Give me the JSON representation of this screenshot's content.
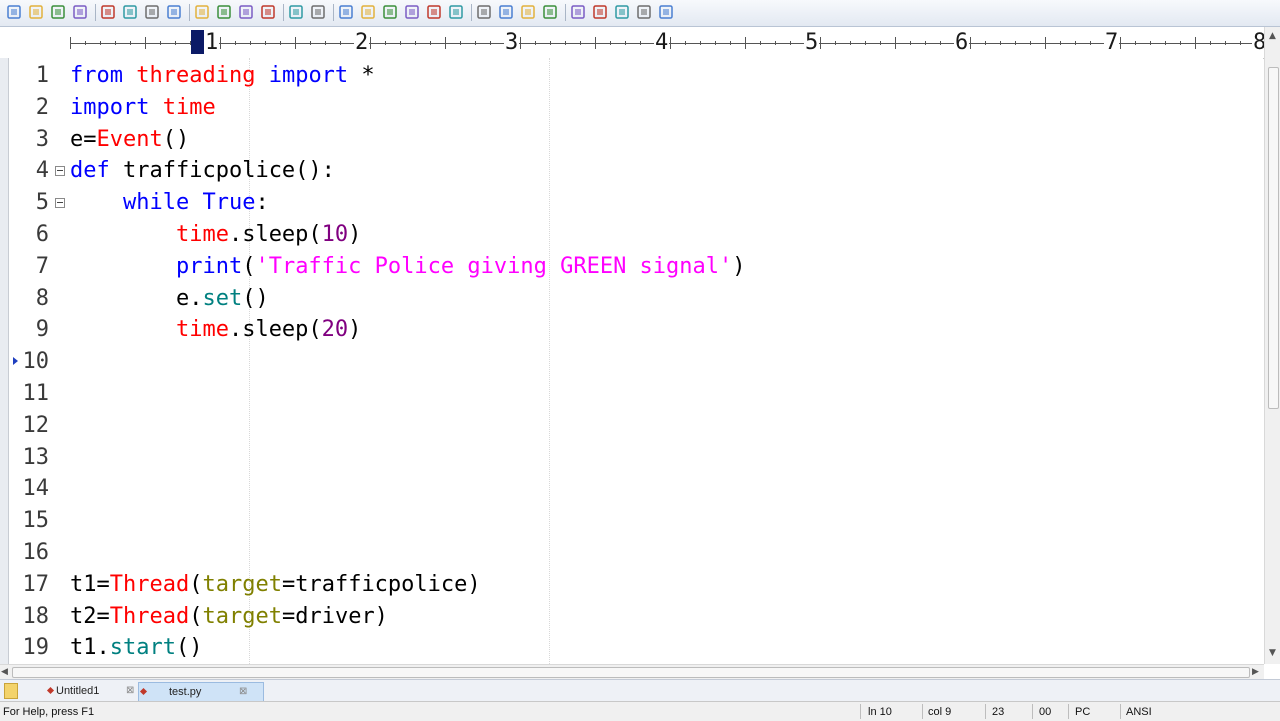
{
  "toolbar": {
    "icons": [
      "new-file-icon",
      "open-icon",
      "save-icon",
      "save-all-icon",
      "print-preview-icon",
      "print-icon",
      "spellcheck-icon",
      "properties-icon",
      "cut-icon",
      "copy-icon",
      "paste-icon",
      "delete-icon",
      "undo-icon",
      "redo-icon",
      "find-icon",
      "replace-icon",
      "find-in-files-icon",
      "goto-icon",
      "font-icon",
      "hex-icon",
      "word-wrap-icon",
      "list-icon",
      "column-icon",
      "check-icon",
      "window-tile-icon",
      "window-cascade-icon",
      "window-list-icon",
      "fullscreen-icon",
      "help-icon"
    ]
  },
  "ruler": {
    "labels": [
      "1",
      "2",
      "3",
      "4",
      "5",
      "6",
      "7",
      "8"
    ]
  },
  "editor": {
    "lines": [
      {
        "num": "1",
        "tokens": [
          [
            "kw",
            "from"
          ],
          [
            "op",
            " "
          ],
          [
            "mod",
            "threading"
          ],
          [
            "op",
            " "
          ],
          [
            "kw",
            "import"
          ],
          [
            "op",
            " *"
          ]
        ]
      },
      {
        "num": "2",
        "tokens": [
          [
            "kw",
            "import"
          ],
          [
            "op",
            " "
          ],
          [
            "mod",
            "time"
          ]
        ]
      },
      {
        "num": "3",
        "tokens": [
          [
            "op",
            "e="
          ],
          [
            "bi",
            "Event"
          ],
          [
            "op",
            "()"
          ]
        ]
      },
      {
        "num": "4",
        "fold": true,
        "tokens": [
          [
            "kw",
            "def"
          ],
          [
            "op",
            " trafficpolice():"
          ]
        ]
      },
      {
        "num": "5",
        "fold": true,
        "tokens": [
          [
            "op",
            "    "
          ],
          [
            "kw",
            "while"
          ],
          [
            "op",
            " "
          ],
          [
            "kw",
            "True"
          ],
          [
            "op",
            ":"
          ]
        ]
      },
      {
        "num": "6",
        "tokens": [
          [
            "op",
            "        "
          ],
          [
            "mod",
            "time"
          ],
          [
            "op",
            ".sleep("
          ],
          [
            "num",
            "10"
          ],
          [
            "op",
            ")"
          ]
        ]
      },
      {
        "num": "7",
        "tokens": [
          [
            "op",
            "        "
          ],
          [
            "kw",
            "print"
          ],
          [
            "op",
            "("
          ],
          [
            "str",
            "'Traffic Police giving GREEN signal'"
          ],
          [
            "op",
            ")"
          ]
        ]
      },
      {
        "num": "8",
        "tokens": [
          [
            "op",
            "        e."
          ],
          [
            "fn",
            "set"
          ],
          [
            "op",
            "()"
          ]
        ]
      },
      {
        "num": "9",
        "tokens": [
          [
            "op",
            "        "
          ],
          [
            "mod",
            "time"
          ],
          [
            "op",
            ".sleep("
          ],
          [
            "num",
            "20"
          ],
          [
            "op",
            ")"
          ]
        ]
      },
      {
        "num": "10",
        "bookmark": true,
        "tokens": []
      },
      {
        "num": "11",
        "tokens": []
      },
      {
        "num": "12",
        "tokens": []
      },
      {
        "num": "13",
        "tokens": []
      },
      {
        "num": "14",
        "tokens": []
      },
      {
        "num": "15",
        "tokens": []
      },
      {
        "num": "16",
        "tokens": []
      },
      {
        "num": "17",
        "tokens": [
          [
            "op",
            "t1="
          ],
          [
            "bi",
            "Thread"
          ],
          [
            "op",
            "("
          ],
          [
            "arg",
            "target"
          ],
          [
            "op",
            "=trafficpolice)"
          ]
        ]
      },
      {
        "num": "18",
        "tokens": [
          [
            "op",
            "t2="
          ],
          [
            "bi",
            "Thread"
          ],
          [
            "op",
            "("
          ],
          [
            "arg",
            "target"
          ],
          [
            "op",
            "=driver)"
          ]
        ]
      },
      {
        "num": "19",
        "tokens": [
          [
            "op",
            "t1."
          ],
          [
            "fn",
            "start"
          ],
          [
            "op",
            "()"
          ]
        ]
      }
    ]
  },
  "tabs": [
    {
      "label": "Untitled1",
      "active": false
    },
    {
      "label": "test.py",
      "active": true
    }
  ],
  "status": {
    "help": "For Help, press F1",
    "line": "ln 10",
    "col": "col 9",
    "code": "23",
    "code2": "00",
    "eol": "PC",
    "encoding": "ANSI"
  },
  "colors": {
    "keyword": "#0000ff",
    "module": "#ff0000",
    "string": "#ff00ff",
    "number": "#800080",
    "function": "#008080",
    "argument": "#808000"
  }
}
